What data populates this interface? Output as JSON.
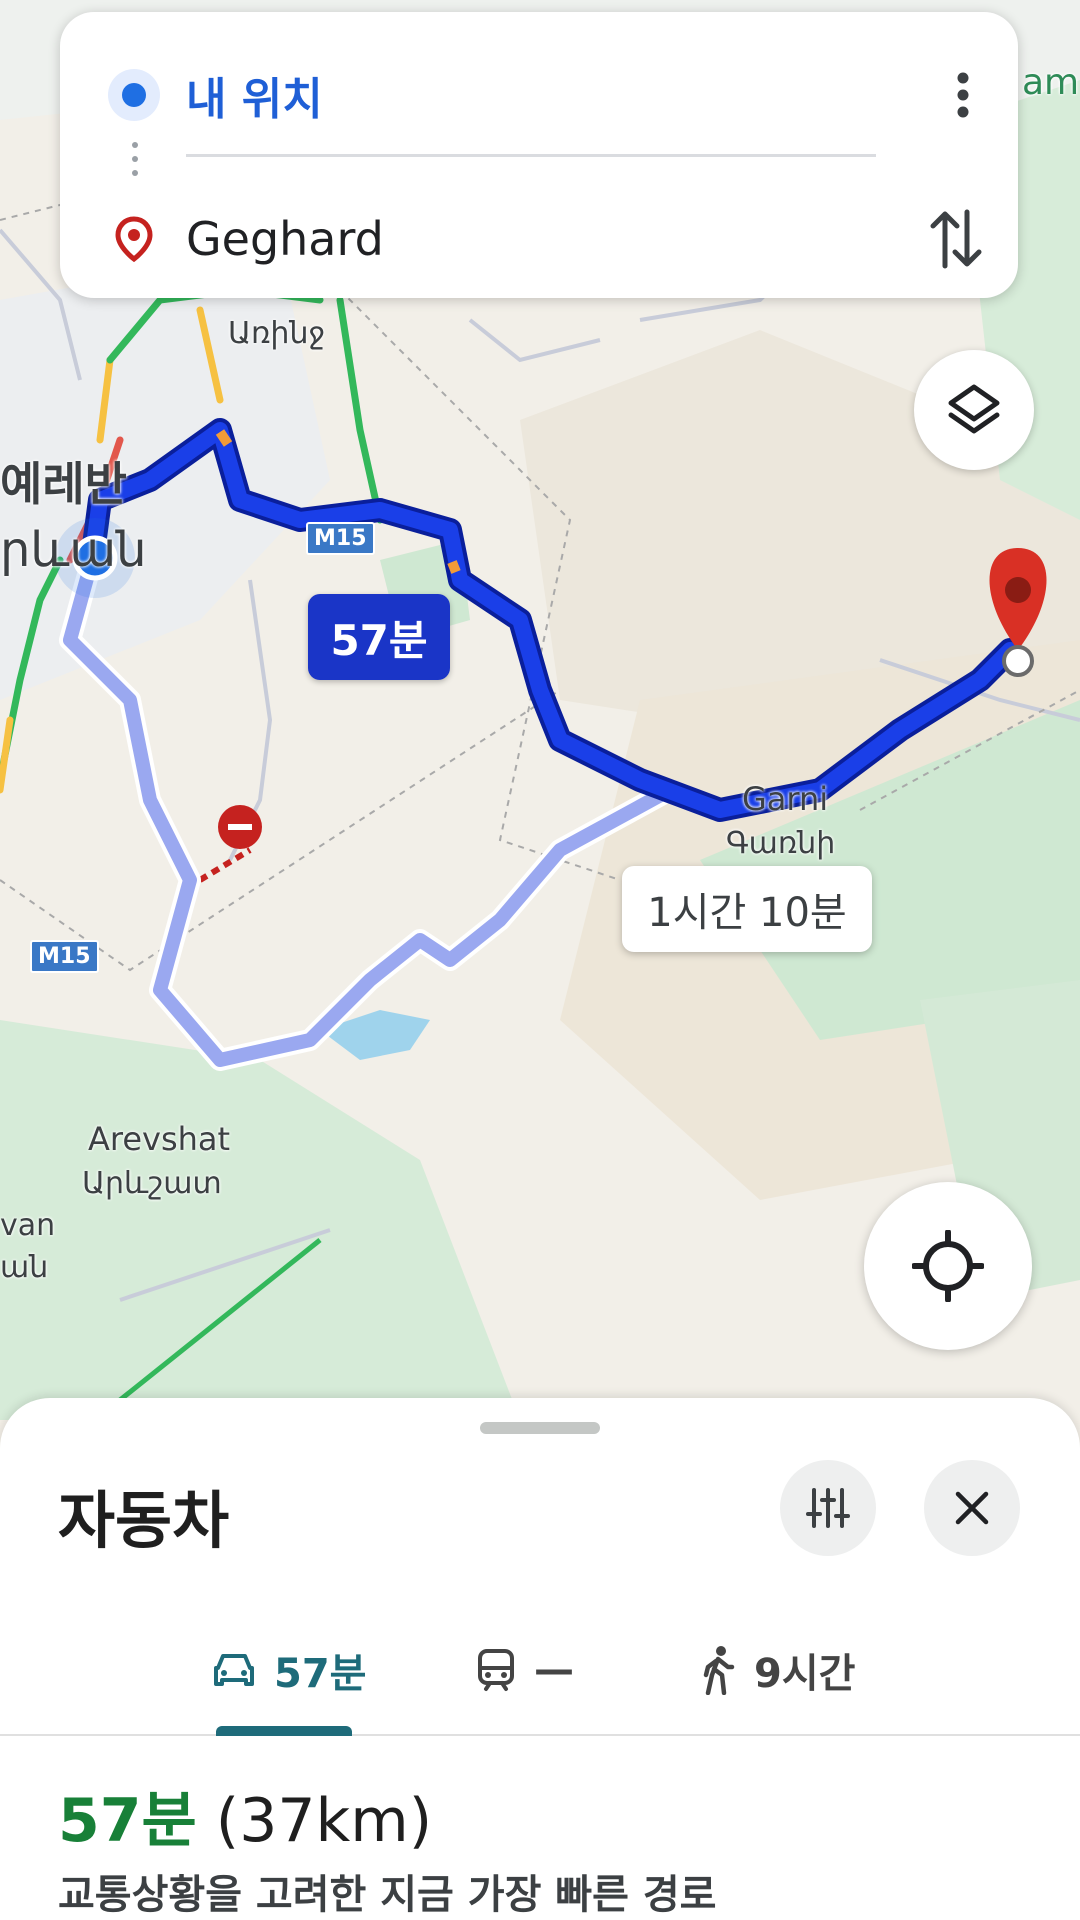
{
  "search": {
    "origin": "내 위치",
    "destination": "Geghard"
  },
  "map": {
    "places": {
      "yerevan_kr": "예레반",
      "yerevan_arm": "րևան",
      "arinj": "Առինջ",
      "garni_en": "Garni",
      "garni_arm": "Գառնի",
      "arevshat_en": "Arevshat",
      "arevshat_arm": "Արևշատ",
      "edge_top": "am",
      "edge_left1": "van",
      "edge_left2": "ան"
    },
    "road_shields": [
      "M15",
      "M15"
    ],
    "route_main_time": "57분",
    "route_alt_time": "1시간 10분",
    "colors": {
      "route_main": "#1a35c7",
      "route_alt": "#9aa8f0",
      "destination_pin": "#d93025"
    }
  },
  "sheet": {
    "title": "자동차",
    "tabs": [
      {
        "mode": "drive",
        "label": "57분",
        "icon": "car-icon",
        "active": true
      },
      {
        "mode": "transit",
        "label": "—",
        "icon": "train-icon",
        "active": false
      },
      {
        "mode": "walk",
        "label": "9시간",
        "icon": "walk-icon",
        "active": false
      }
    ],
    "summary": {
      "duration": "57분",
      "distance": "(37km)",
      "description": "교통상황을 고려한 지금 가장 빠른 경로"
    }
  },
  "colors": {
    "accent_tab": "#1e6b7a",
    "duration_green": "#188038",
    "origin_blue": "#1f5fd6"
  }
}
